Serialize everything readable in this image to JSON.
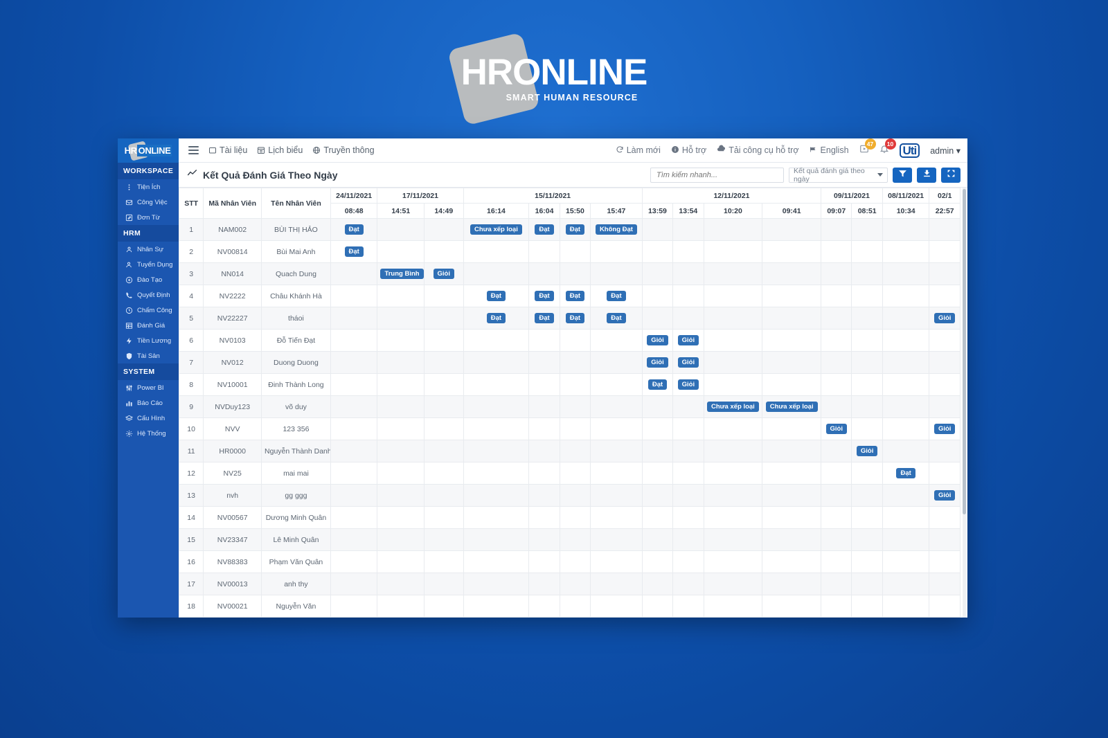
{
  "wallpaper": {
    "logo_main": "HR",
    "logo_accent": "ONLINE",
    "logo_sub": "SMART HUMAN RESOURCE"
  },
  "topbar": {
    "brand_hr": "HR",
    "brand_online": "ONLINE",
    "menu": [
      {
        "label": "Tài liệu",
        "icon": "folder-icon"
      },
      {
        "label": "Lịch biểu",
        "icon": "calendar-icon"
      },
      {
        "label": "Truyền thông",
        "icon": "globe-icon"
      }
    ],
    "right": [
      {
        "label": "Làm mới",
        "icon": "refresh-icon"
      },
      {
        "label": "Hỗ trợ",
        "icon": "info-icon"
      },
      {
        "label": "Tải công cụ hỗ trợ",
        "icon": "cloud-download-icon"
      },
      {
        "label": "English",
        "icon": "flag-icon"
      }
    ],
    "badge_messages": "47",
    "badge_notifications": "10",
    "account_logo": "Uti",
    "account_name": "admin"
  },
  "sidebar": {
    "groups": [
      {
        "title": "WORKSPACE",
        "items": [
          {
            "label": "Tiện Ích",
            "icon": "dots-vertical-icon"
          },
          {
            "label": "Công Việc",
            "icon": "inbox-icon"
          },
          {
            "label": "Đơn Từ",
            "icon": "edit-square-icon"
          }
        ]
      },
      {
        "title": "HRM",
        "items": [
          {
            "label": "Nhân Sự",
            "icon": "user-icon"
          },
          {
            "label": "Tuyển Dụng",
            "icon": "user-plus-icon"
          },
          {
            "label": "Đào Tạo",
            "icon": "plus-circle-icon"
          },
          {
            "label": "Quyết Định",
            "icon": "phone-icon"
          },
          {
            "label": "Chấm Công",
            "icon": "clock-icon"
          },
          {
            "label": "Đánh Giá",
            "icon": "table-icon"
          },
          {
            "label": "Tiền Lương",
            "icon": "bolt-icon"
          },
          {
            "label": "Tài Sản",
            "icon": "shield-icon"
          }
        ]
      },
      {
        "title": "SYSTEM",
        "items": [
          {
            "label": "Power BI",
            "icon": "sliders-icon"
          },
          {
            "label": "Báo Cáo",
            "icon": "bar-chart-icon"
          },
          {
            "label": "Cấu Hình",
            "icon": "layers-icon"
          },
          {
            "label": "Hệ Thống",
            "icon": "gear-icon"
          }
        ]
      }
    ]
  },
  "page": {
    "title": "Kết Quả Đánh Giá Theo Ngày",
    "title_icon": "trend-line-icon",
    "search_placeholder": "Tìm kiếm nhanh...",
    "search_value": "",
    "select_value": "Kết quả đánh giá theo ngày",
    "buttons": [
      {
        "name": "filter-button",
        "icon": "funnel-icon"
      },
      {
        "name": "download-button",
        "icon": "download-icon"
      },
      {
        "name": "fullscreen-button",
        "icon": "expand-icon"
      }
    ]
  },
  "table": {
    "fixed_headers": [
      "STT",
      "Mã Nhân Viên",
      "Tên Nhân Viên"
    ],
    "date_groups": [
      {
        "date": "24/11/2021",
        "times": [
          "08:48"
        ]
      },
      {
        "date": "17/11/2021",
        "times": [
          "14:51",
          "14:49"
        ]
      },
      {
        "date": "15/11/2021",
        "times": [
          "16:14",
          "16:04",
          "15:50",
          "15:47"
        ]
      },
      {
        "date": "12/11/2021",
        "times": [
          "13:59",
          "13:54",
          "10:20",
          "09:41"
        ]
      },
      {
        "date": "09/11/2021",
        "times": [
          "09:07",
          "08:51"
        ]
      },
      {
        "date": "08/11/2021",
        "times": [
          "10:34"
        ]
      },
      {
        "date": "02/1",
        "times": [
          "22:57"
        ]
      }
    ],
    "rows": [
      {
        "stt": "1",
        "code": "NAM002",
        "name": "BÙI THỊ HẢO",
        "cells": [
          "Đạt",
          "",
          "",
          "Chưa xếp loại",
          "Đạt",
          "Đạt",
          "Không Đạt",
          "",
          "",
          "",
          "",
          "",
          "",
          "",
          ""
        ]
      },
      {
        "stt": "2",
        "code": "NV00814",
        "name": "Bùi Mai Anh",
        "cells": [
          "Đạt",
          "",
          "",
          "",
          "",
          "",
          "",
          "",
          "",
          "",
          "",
          "",
          "",
          "",
          ""
        ]
      },
      {
        "stt": "3",
        "code": "NN014",
        "name": "Quach Dung",
        "cells": [
          "",
          "Trung Bình",
          "Giỏi",
          "",
          "",
          "",
          "",
          "",
          "",
          "",
          "",
          "",
          "",
          "",
          ""
        ]
      },
      {
        "stt": "4",
        "code": "NV2222",
        "name": "Châu Khánh Hà",
        "cells": [
          "",
          "",
          "",
          "Đạt",
          "Đạt",
          "Đạt",
          "Đạt",
          "",
          "",
          "",
          "",
          "",
          "",
          "",
          ""
        ]
      },
      {
        "stt": "5",
        "code": "NV22227",
        "name": "tháoi",
        "cells": [
          "",
          "",
          "",
          "Đạt",
          "Đạt",
          "Đạt",
          "Đạt",
          "",
          "",
          "",
          "",
          "",
          "",
          "",
          "Giỏi"
        ]
      },
      {
        "stt": "6",
        "code": "NV0103",
        "name": "Đỗ Tiến Đạt",
        "cells": [
          "",
          "",
          "",
          "",
          "",
          "",
          "",
          "Giỏi",
          "Giỏi",
          "",
          "",
          "",
          "",
          "",
          ""
        ]
      },
      {
        "stt": "7",
        "code": "NV012",
        "name": "Duong Duong",
        "cells": [
          "",
          "",
          "",
          "",
          "",
          "",
          "",
          "Giỏi",
          "Giỏi",
          "",
          "",
          "",
          "",
          "",
          ""
        ]
      },
      {
        "stt": "8",
        "code": "NV10001",
        "name": "Đinh Thành Long",
        "cells": [
          "",
          "",
          "",
          "",
          "",
          "",
          "",
          "Đạt",
          "Giỏi",
          "",
          "",
          "",
          "",
          "",
          ""
        ]
      },
      {
        "stt": "9",
        "code": "NVDuy123",
        "name": "võ duy",
        "cells": [
          "",
          "",
          "",
          "",
          "",
          "",
          "",
          "",
          "",
          "Chưa xếp loại",
          "Chưa xếp loại",
          "",
          "",
          "",
          ""
        ]
      },
      {
        "stt": "10",
        "code": "NVV",
        "name": "123 356",
        "cells": [
          "",
          "",
          "",
          "",
          "",
          "",
          "",
          "",
          "",
          "",
          "",
          "Giỏi",
          "",
          "",
          "Giỏi"
        ]
      },
      {
        "stt": "11",
        "code": "HR0000",
        "name": "Nguyễn Thành Danh",
        "cells": [
          "",
          "",
          "",
          "",
          "",
          "",
          "",
          "",
          "",
          "",
          "",
          "",
          "Giỏi",
          "",
          ""
        ]
      },
      {
        "stt": "12",
        "code": "NV25",
        "name": "mai mai",
        "cells": [
          "",
          "",
          "",
          "",
          "",
          "",
          "",
          "",
          "",
          "",
          "",
          "",
          "",
          "Đạt",
          ""
        ]
      },
      {
        "stt": "13",
        "code": "nvh",
        "name": "gg ggg",
        "cells": [
          "",
          "",
          "",
          "",
          "",
          "",
          "",
          "",
          "",
          "",
          "",
          "",
          "",
          "",
          "Giỏi"
        ]
      },
      {
        "stt": "14",
        "code": "NV00567",
        "name": "Dương Minh Quân",
        "cells": [
          "",
          "",
          "",
          "",
          "",
          "",
          "",
          "",
          "",
          "",
          "",
          "",
          "",
          "",
          ""
        ]
      },
      {
        "stt": "15",
        "code": "NV23347",
        "name": "Lê Minh Quân",
        "cells": [
          "",
          "",
          "",
          "",
          "",
          "",
          "",
          "",
          "",
          "",
          "",
          "",
          "",
          "",
          ""
        ]
      },
      {
        "stt": "16",
        "code": "NV88383",
        "name": "Phạm Văn Quân",
        "cells": [
          "",
          "",
          "",
          "",
          "",
          "",
          "",
          "",
          "",
          "",
          "",
          "",
          "",
          "",
          ""
        ]
      },
      {
        "stt": "17",
        "code": "NV00013",
        "name": "anh thy",
        "cells": [
          "",
          "",
          "",
          "",
          "",
          "",
          "",
          "",
          "",
          "",
          "",
          "",
          "",
          "",
          ""
        ]
      },
      {
        "stt": "18",
        "code": "NV00021",
        "name": "Nguyễn Văn",
        "cells": [
          "",
          "",
          "",
          "",
          "",
          "",
          "",
          "",
          "",
          "",
          "",
          "",
          "",
          "",
          ""
        ]
      }
    ]
  },
  "colors": {
    "brand_blue": "#1565c0",
    "sidebar_blue": "#1b56b0",
    "pill_blue": "#2f6fb5",
    "badge_orange": "#f0ad2e",
    "badge_red": "#e03b3b"
  }
}
